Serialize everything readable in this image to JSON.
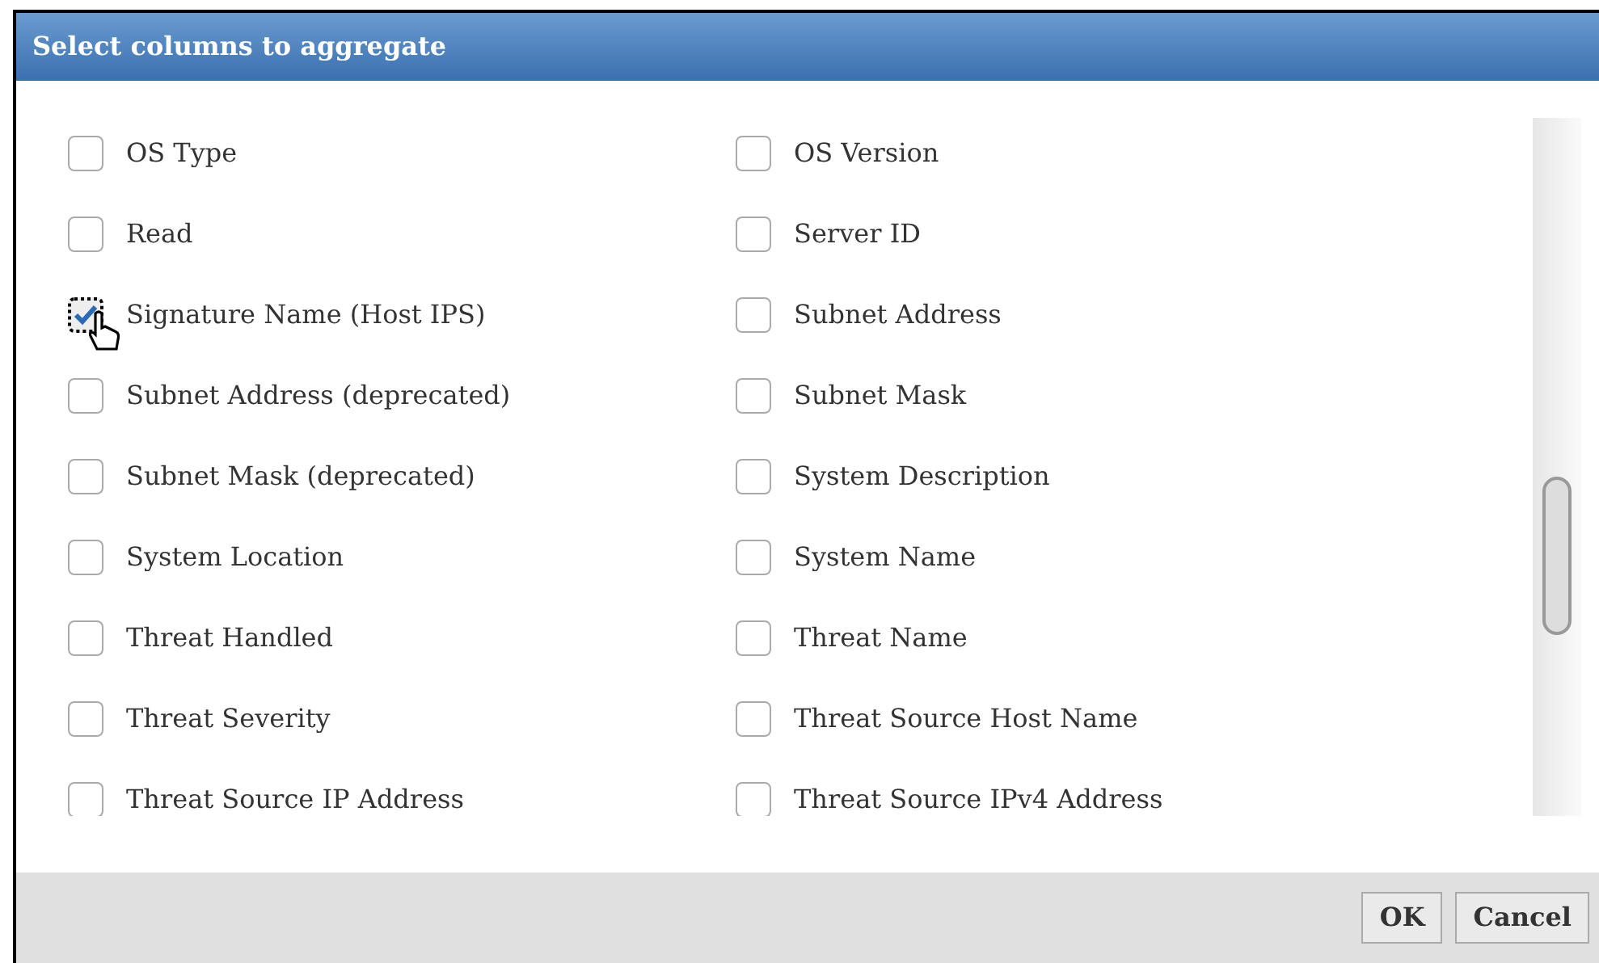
{
  "dialog": {
    "title": "Select columns to aggregate"
  },
  "columns": [
    {
      "label": "OS Type",
      "checked": false
    },
    {
      "label": "OS Version",
      "checked": false
    },
    {
      "label": "Read",
      "checked": false
    },
    {
      "label": "Server ID",
      "checked": false
    },
    {
      "label": "Signature Name (Host IPS)",
      "checked": true
    },
    {
      "label": "Subnet Address",
      "checked": false
    },
    {
      "label": "Subnet Address (deprecated)",
      "checked": false
    },
    {
      "label": "Subnet Mask",
      "checked": false
    },
    {
      "label": "Subnet Mask (deprecated)",
      "checked": false
    },
    {
      "label": "System Description",
      "checked": false
    },
    {
      "label": "System Location",
      "checked": false
    },
    {
      "label": "System Name",
      "checked": false
    },
    {
      "label": "Threat Handled",
      "checked": false
    },
    {
      "label": "Threat Name",
      "checked": false
    },
    {
      "label": "Threat Severity",
      "checked": false
    },
    {
      "label": "Threat Source Host Name",
      "checked": false
    },
    {
      "label": "Threat Source IP Address",
      "checked": false
    },
    {
      "label": "Threat Source IPv4 Address",
      "checked": false
    }
  ],
  "buttons": [
    "OK",
    "Cancel"
  ]
}
